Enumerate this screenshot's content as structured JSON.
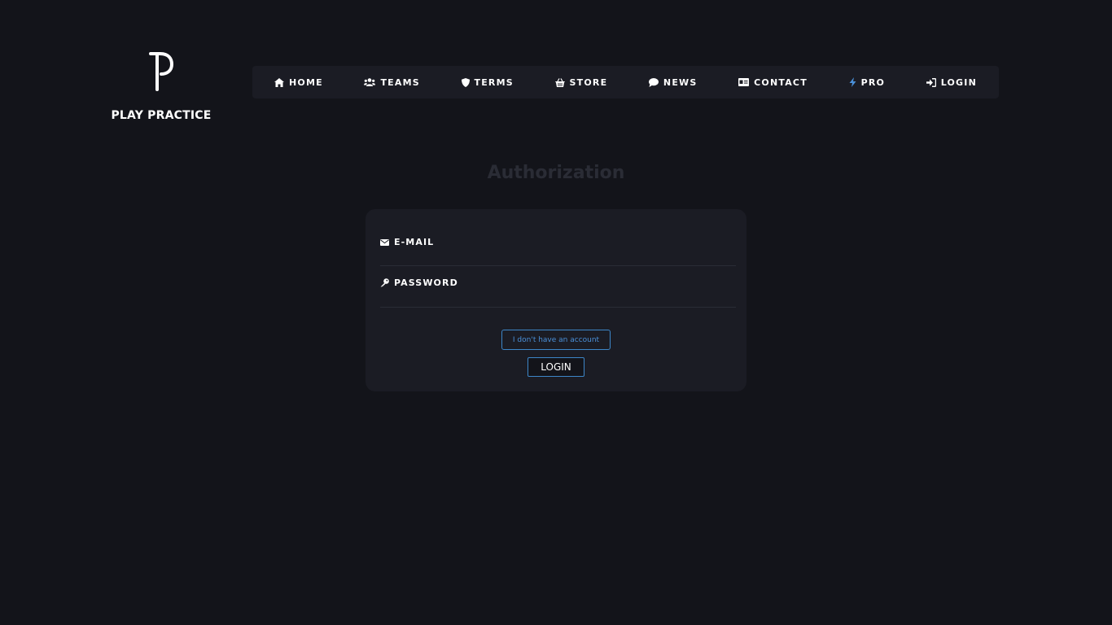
{
  "brand": {
    "name": "PLAY PRACTICE",
    "logo_icon": "pp-logo-icon"
  },
  "nav": {
    "items": [
      {
        "label": "HOME",
        "icon": "home-icon"
      },
      {
        "label": "TEAMS",
        "icon": "users-icon"
      },
      {
        "label": "TERMS",
        "icon": "shield-icon"
      },
      {
        "label": "STORE",
        "icon": "basket-icon"
      },
      {
        "label": "NEWS",
        "icon": "comment-icon"
      },
      {
        "label": "CONTACT",
        "icon": "id-card-icon"
      },
      {
        "label": "PRO",
        "icon": "bolt-icon"
      },
      {
        "label": "LOGIN",
        "icon": "sign-in-icon"
      }
    ]
  },
  "auth": {
    "title": "Authorization",
    "email_label": "E-MAIL",
    "email_value": "",
    "password_label": "PASSWORD",
    "password_value": "",
    "no_account_label": "I don't have an account",
    "login_button": "LOGIN"
  },
  "colors": {
    "background": "#13141a",
    "panel": "#1b1c24",
    "accent": "#3d86c8",
    "pro_bolt": "#4a90d9"
  }
}
